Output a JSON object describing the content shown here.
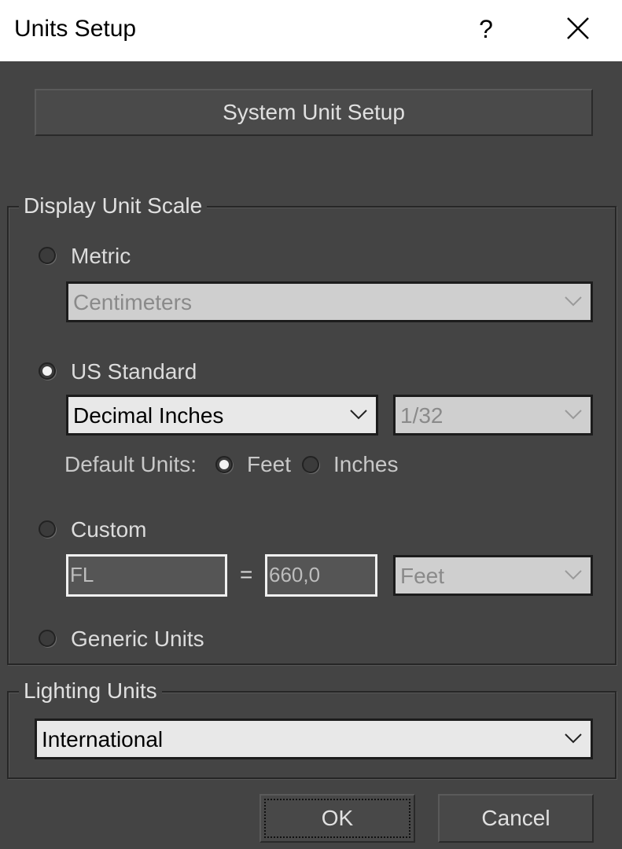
{
  "window": {
    "title": "Units Setup",
    "help_label": "?",
    "close_icon": "close-icon"
  },
  "system_unit_setup_label": "System Unit Setup",
  "display_unit_scale": {
    "legend": "Display Unit Scale",
    "metric": {
      "label": "Metric",
      "selected": false,
      "dropdown_value": "Centimeters",
      "dropdown_enabled": false
    },
    "us_standard": {
      "label": "US Standard",
      "selected": true,
      "unit_dropdown_value": "Decimal Inches",
      "fraction_dropdown_value": "1/32",
      "fraction_enabled": false,
      "default_units_label": "Default Units:",
      "feet_label": "Feet",
      "inches_label": "Inches",
      "default_units_selected": "Feet"
    },
    "custom": {
      "label": "Custom",
      "selected": false,
      "name_value": "FL",
      "equals": "=",
      "amount_value": "660,0",
      "unit_dropdown_value": "Feet",
      "unit_enabled": false
    },
    "generic": {
      "label": "Generic Units",
      "selected": false
    }
  },
  "lighting_units": {
    "legend": "Lighting Units",
    "dropdown_value": "International"
  },
  "buttons": {
    "ok_label": "OK",
    "cancel_label": "Cancel"
  }
}
